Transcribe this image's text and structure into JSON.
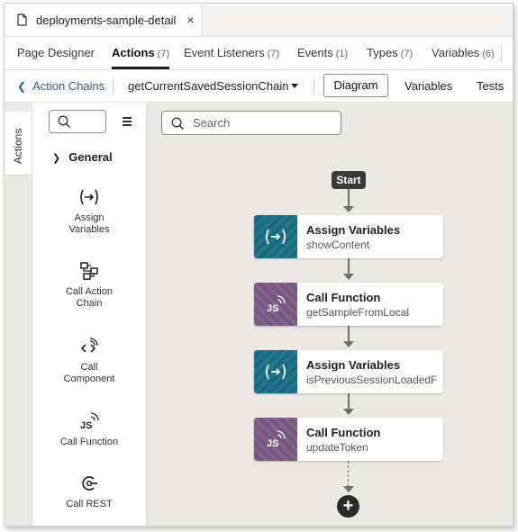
{
  "file_tab": {
    "title": "deployments-sample-detail",
    "icon": "document-icon",
    "close": "×"
  },
  "tabs": [
    {
      "label": "Page Designer",
      "count": ""
    },
    {
      "label": "Actions",
      "count": "(7)"
    },
    {
      "label": "Event Listeners",
      "count": "(7)"
    },
    {
      "label": "Events",
      "count": "(1)"
    },
    {
      "label": "Types",
      "count": "(7)"
    },
    {
      "label": "Variables",
      "count": "(6)"
    }
  ],
  "active_tab": "Actions",
  "toolbar": {
    "back_label": "Action Chains",
    "chain_name": "getCurrentSavedSessionChain",
    "view_diagram": "Diagram",
    "view_variables": "Variables",
    "view_tests": "Tests"
  },
  "rail": {
    "tab_label": "Actions"
  },
  "palette": {
    "group_label": "General",
    "items": [
      {
        "label_line1": "Assign",
        "label_line2": "Variables",
        "icon": "assign-variables-icon"
      },
      {
        "label_line1": "Call Action",
        "label_line2": "Chain",
        "icon": "call-action-chain-icon"
      },
      {
        "label_line1": "Call",
        "label_line2": "Component",
        "icon": "call-component-icon"
      },
      {
        "label_line1": "Call Function",
        "label_line2": "",
        "icon": "call-function-icon"
      },
      {
        "label_line1": "Call REST",
        "label_line2": "",
        "icon": "call-rest-icon"
      }
    ]
  },
  "canvas": {
    "search_placeholder": "Search",
    "start_label": "Start",
    "nodes": [
      {
        "title": "Assign Variables",
        "subtitle": "showContent",
        "kind": "assign",
        "color": "#166f85"
      },
      {
        "title": "Call Function",
        "subtitle": "getSampleFromLocal",
        "kind": "function",
        "color": "#7b5a86"
      },
      {
        "title": "Assign Variables",
        "subtitle": "isPreviousSessionLoadedF",
        "kind": "assign",
        "color": "#166f85"
      },
      {
        "title": "Call Function",
        "subtitle": "updateToken",
        "kind": "function",
        "color": "#7b5a86"
      }
    ],
    "add_label": "+"
  }
}
